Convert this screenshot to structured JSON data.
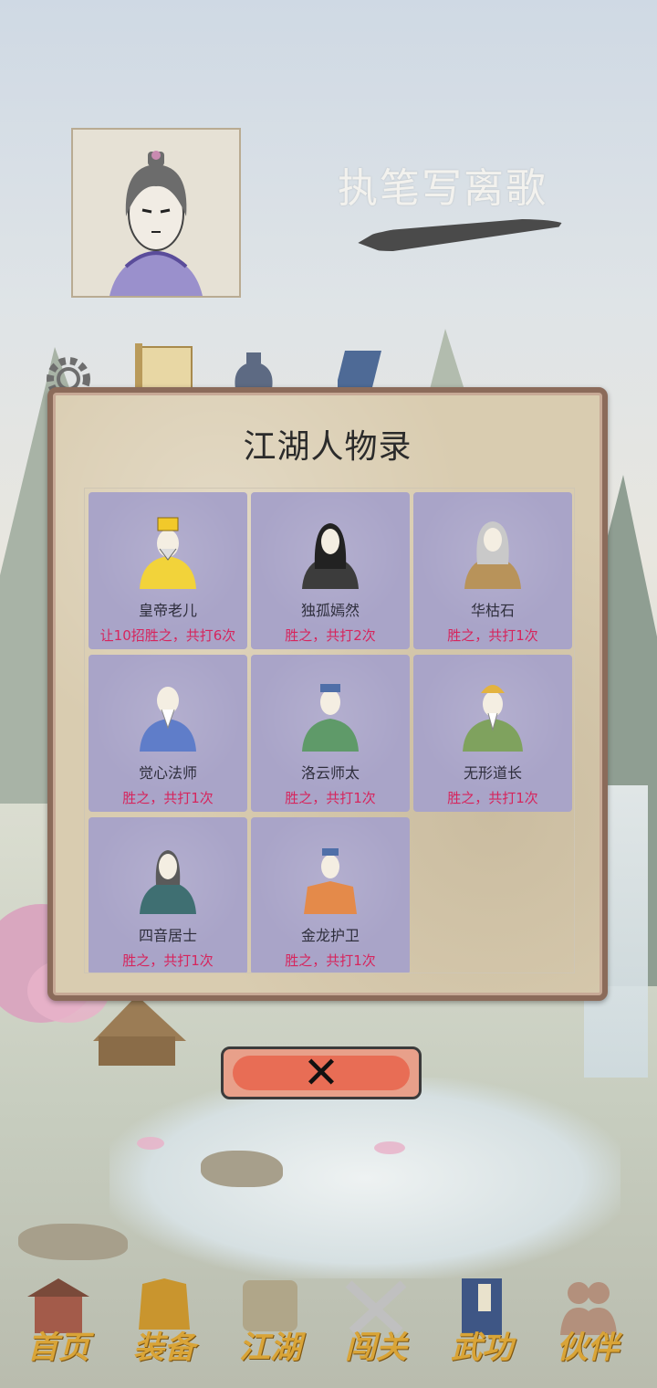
{
  "header": {
    "player_name": "执笔写离歌",
    "top_icons": [
      "gear-icon",
      "scroll-icon",
      "bag-icon",
      "book-icon"
    ]
  },
  "panel": {
    "title": "江湖人物录",
    "characters": [
      {
        "name": "皇帝老儿",
        "record": "让10招胜之，共打6次",
        "color": "#f2d33a",
        "icon": "emperor-portrait-icon"
      },
      {
        "name": "独孤嫣然",
        "record": "胜之，共打2次",
        "color": "#3c3c3c",
        "icon": "woman-portrait-icon"
      },
      {
        "name": "华枯石",
        "record": "胜之，共打1次",
        "color": "#b8935a",
        "icon": "elder-portrait-icon"
      },
      {
        "name": "觉心法师",
        "record": "胜之，共打1次",
        "color": "#5f7dc9",
        "icon": "monk-portrait-icon"
      },
      {
        "name": "洛云师太",
        "record": "胜之，共打1次",
        "color": "#5f9a69",
        "icon": "nun-portrait-icon"
      },
      {
        "name": "无形道长",
        "record": "胜之，共打1次",
        "color": "#7fa25e",
        "icon": "taoist-portrait-icon"
      },
      {
        "name": "四音居士",
        "record": "胜之，共打1次",
        "color": "#3f6f72",
        "icon": "scholar-portrait-icon"
      },
      {
        "name": "金龙护卫",
        "record": "胜之，共打1次",
        "color": "#e48a4a",
        "icon": "guard-portrait-icon"
      }
    ],
    "close_label": "✕"
  },
  "nav": {
    "items": [
      {
        "label": "首页",
        "icon": "house-icon"
      },
      {
        "label": "装备",
        "icon": "armor-icon"
      },
      {
        "label": "江湖",
        "icon": "map-scroll-icon"
      },
      {
        "label": "闯关",
        "icon": "crossed-swords-icon"
      },
      {
        "label": "武功",
        "icon": "manual-book-icon"
      },
      {
        "label": "伙伴",
        "icon": "companions-icon"
      }
    ]
  },
  "colors": {
    "panel_border": "#8b6b5a",
    "card_bg": "#a9a4c8",
    "record_text": "#d6255d",
    "nav_label": "#d9a437",
    "close_fill": "#e86d55"
  }
}
